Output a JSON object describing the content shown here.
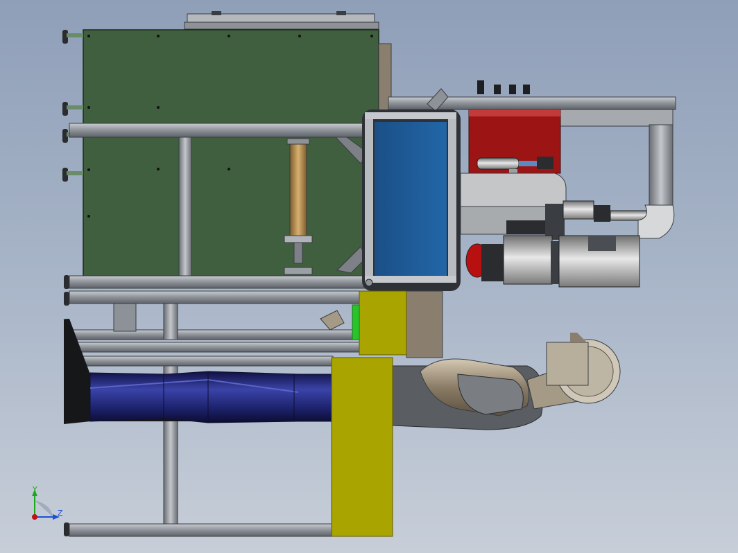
{
  "viewport": {
    "background_top": "#8f9fb8",
    "background_bottom": "#c7ced8"
  },
  "triad": {
    "y_label": "Y",
    "z_label": "Z",
    "y_color": "#1fa51f",
    "z_color": "#1a4fd8",
    "x_color": "#c01010"
  },
  "colors": {
    "green_panel": "#3f5f3f",
    "blue_panel": "#1f5a94",
    "red_box": "#9c1414",
    "yellow_block": "#a9a400",
    "aluminum": "#9aa0a6",
    "dark_frame": "#3a3d42",
    "blue_hose": "#232a7a",
    "brass_cylinder": "#b8924c",
    "motor_grey": "#bdbdbd",
    "duct_tan": "#a49a86",
    "accent_green": "#29c429"
  }
}
